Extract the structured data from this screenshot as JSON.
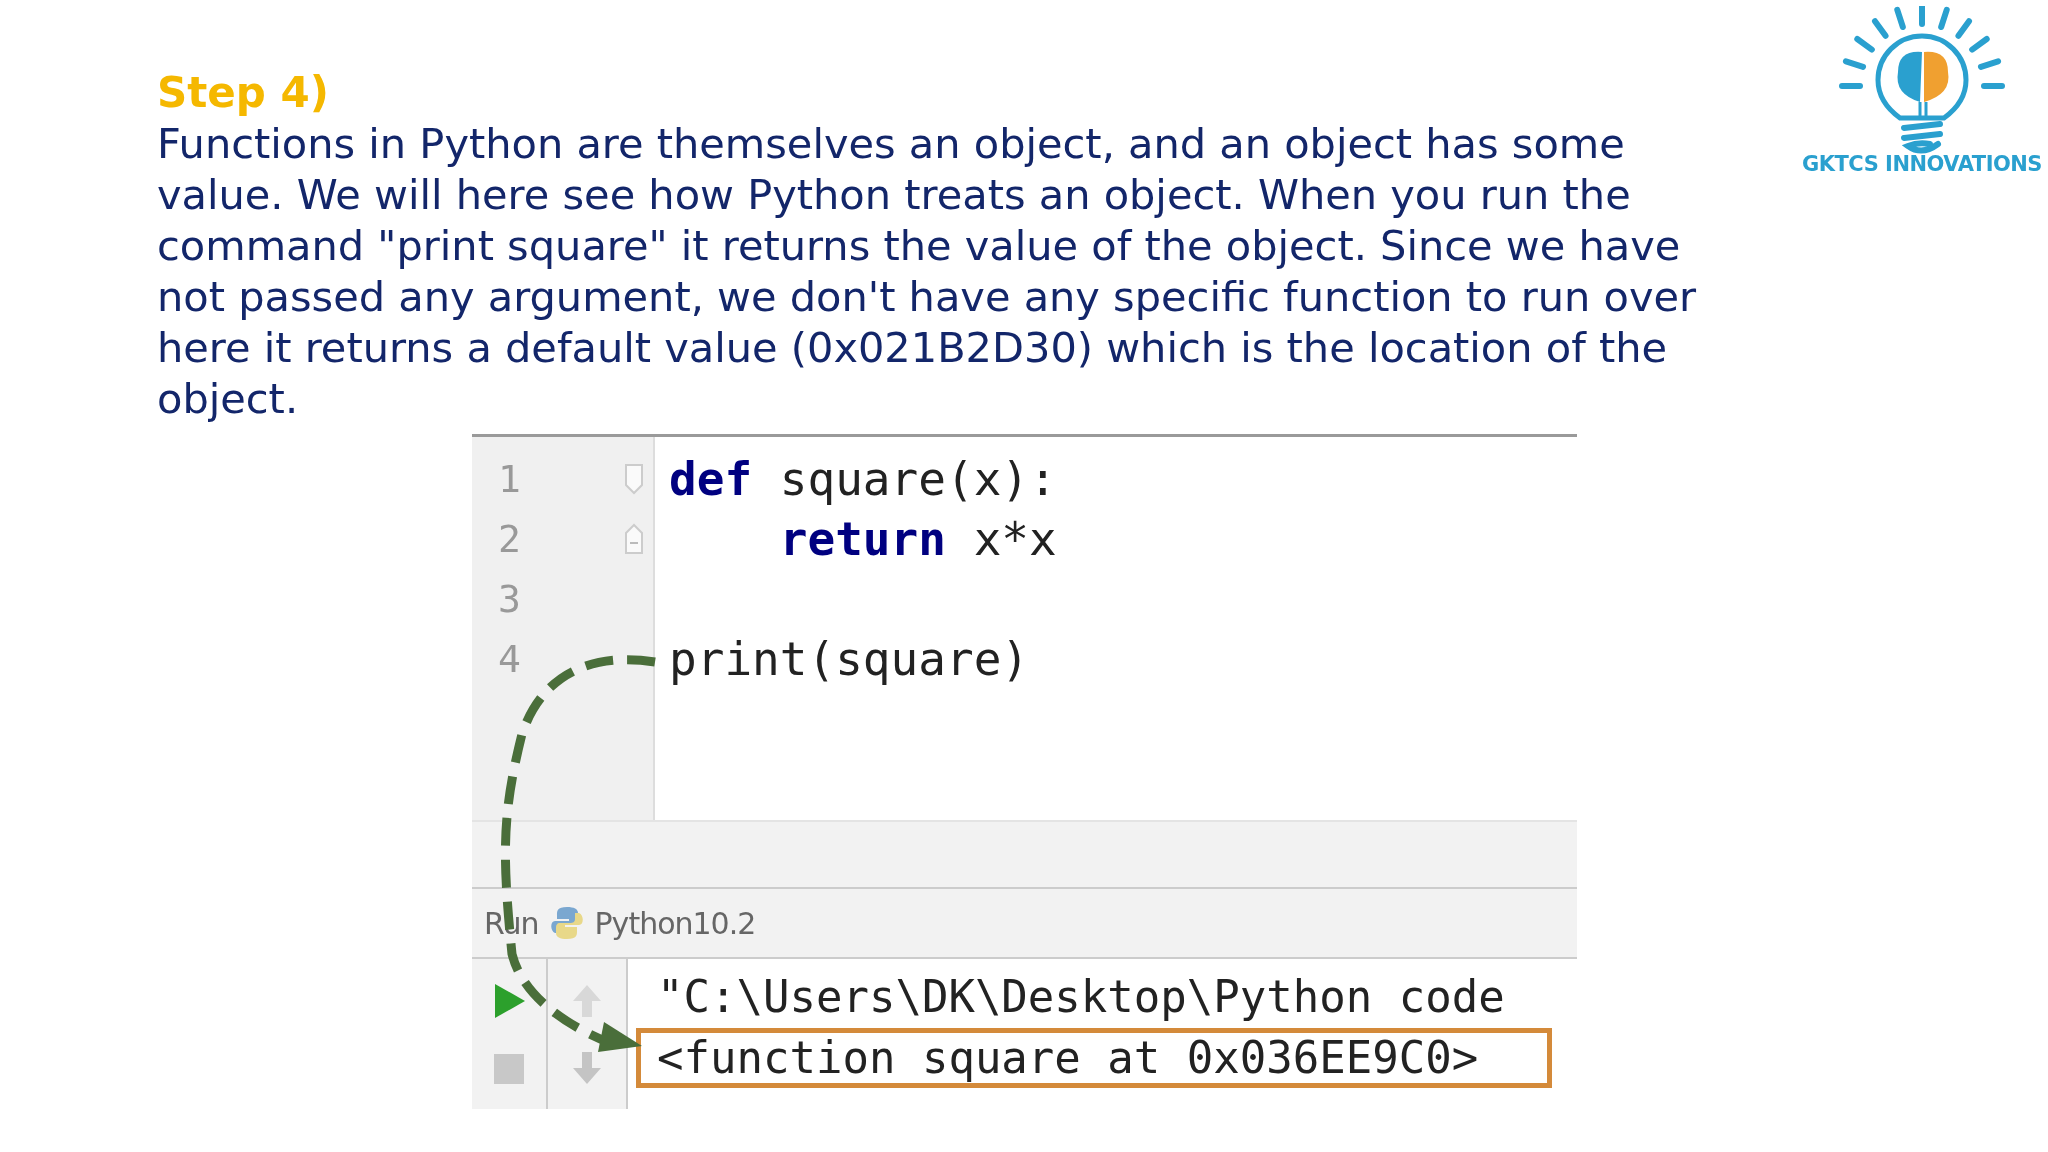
{
  "step_title": "Step 4)",
  "description": "Functions in Python are themselves an object, and an object has some value. We will here see how Python treats an object. When you run the command \"print square\" it returns the value of the object. Since we have not passed any argument, we don't have any specific function to run over here it returns a default value (0x021B2D30) which is the location of the object.",
  "logo": {
    "name": "GKTCS INNOVATIONS"
  },
  "ide": {
    "editor": {
      "lines": [
        {
          "number": "1",
          "fold": true,
          "tokens": [
            {
              "kind": "keyword",
              "text": "def"
            },
            {
              "kind": "plain",
              "text": " square(x):"
            }
          ]
        },
        {
          "number": "2",
          "fold": true,
          "tokens": [
            {
              "kind": "keyword",
              "text": "    return"
            },
            {
              "kind": "plain",
              "text": " x*x"
            }
          ]
        },
        {
          "number": "3",
          "fold": false
        },
        {
          "number": "4",
          "fold": false,
          "tokens": [
            {
              "kind": "plain",
              "text": "print(square)"
            }
          ]
        }
      ]
    },
    "run_bar": {
      "tab": "Run",
      "config": "Python10.2"
    },
    "console": {
      "lines": [
        {
          "text": "\"C:\\Users\\DK\\Desktop\\Python code",
          "highlighted": false
        },
        {
          "text": "<function square at 0x036EE9C0>",
          "highlighted": true
        }
      ]
    }
  }
}
